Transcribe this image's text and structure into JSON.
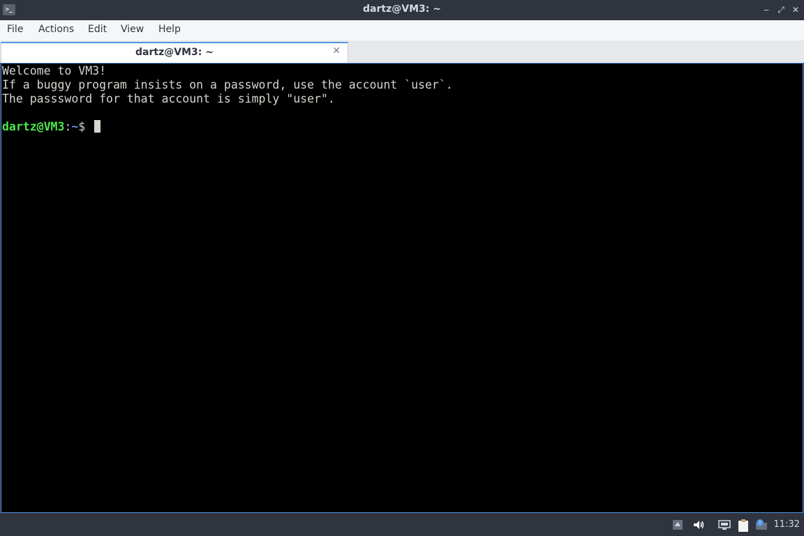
{
  "window": {
    "title": "dartz@VM3: ~",
    "app_icon": "terminal-icon"
  },
  "menubar": {
    "items": [
      "File",
      "Actions",
      "Edit",
      "View",
      "Help"
    ]
  },
  "tabs": [
    {
      "label": "dartz@VM3: ~",
      "active": true
    }
  ],
  "terminal": {
    "lines": [
      "Welcome to VM3!",
      "If a buggy program insists on a password, use the account `user`.",
      "The passsword for that account is simply \"user\".",
      ""
    ],
    "prompt": {
      "user_host": "dartz@VM3",
      "colon": ":",
      "path": "~",
      "symbol": "$ "
    }
  },
  "taskbar": {
    "clock": "11:32",
    "tray_icons": [
      "tray-up-arrow-icon",
      "volume-icon",
      "network-icon",
      "clipboard-icon",
      "notification-icon"
    ]
  },
  "colors": {
    "accent": "#5294e2",
    "prompt_user": "#4ce64c",
    "prompt_path": "#6a8fe8",
    "terminal_bg": "#000000",
    "terminal_fg": "#d3d7cf"
  }
}
